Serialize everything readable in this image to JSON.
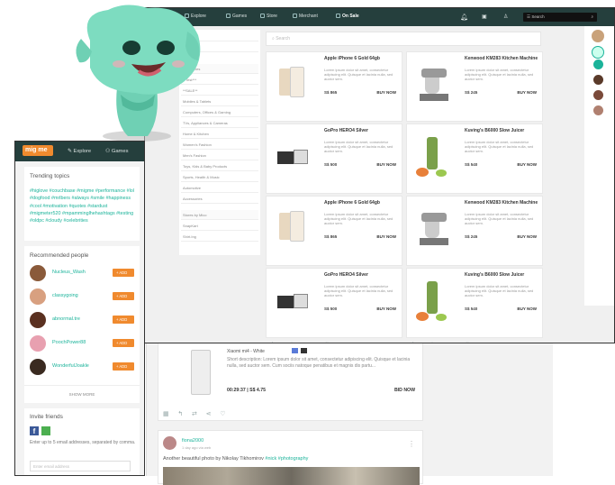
{
  "topnav": {
    "explore": "Explore",
    "games": "Games",
    "store": "Store",
    "merchant": "Merchant",
    "onsale": "On Sale",
    "search_label": "Search"
  },
  "search_placeholder": "Search",
  "categories": {
    "top": [
      "Games",
      "Ringtones",
      "Categories",
      "**Test***",
      "**SALE**",
      "Mobiles & Tablets",
      "Computers, Offices & Gaming",
      "TVs, Appliances & Cameras",
      "Home & Kitchen",
      "Women's Fashion",
      "Men's Fashion",
      "Toys, Kids & Baby Products",
      "Sports, Health & Music",
      "Automotive",
      "Accessories"
    ],
    "section": "Stores by Mico",
    "stores": [
      "SnapKart",
      "Shirt.Ing"
    ]
  },
  "products": [
    {
      "title": "Apple iPhone 6 Gold 64gb",
      "desc": "Lorem ipsum dolor sit amet, consectetur adipiscing elit. Quisque et lacinia nulla, sed auctor sem.",
      "price": "S$ 865",
      "buy": "BUY NOW"
    },
    {
      "title": "Kenwood KM283 Kitchen Machine",
      "desc": "Lorem ipsum dolor sit amet, consectetur adipiscing elit. Quisque et lacinia nulla, sed auctor sem.",
      "price": "S$ 245",
      "buy": "BUY NOW"
    },
    {
      "title": "GoPro HERO4 Silver",
      "desc": "Lorem ipsum dolor sit amet, consectetur adipiscing elit. Quisque et lacinia nulla, sed auctor sem.",
      "price": "S$ 500",
      "buy": "BUY NOW"
    },
    {
      "title": "Kuving's B6000 Slow Juicer",
      "desc": "Lorem ipsum dolor sit amet, consectetur adipiscing elit. Quisque et lacinia nulla, sed auctor sem.",
      "price": "S$ 540",
      "buy": "BUY NOW"
    },
    {
      "title": "Apple iPhone 6 Gold 64gb",
      "desc": "Lorem ipsum dolor sit amet, consectetur adipiscing elit. Quisque et lacinia nulla, sed auctor sem.",
      "price": "S$ 865",
      "buy": "BUY NOW"
    },
    {
      "title": "Kenwood KM283 Kitchen Machine",
      "desc": "Lorem ipsum dolor sit amet, consectetur adipiscing elit. Quisque et lacinia nulla, sed auctor sem.",
      "price": "S$ 245",
      "buy": "BUY NOW"
    },
    {
      "title": "GoPro HERO4 Silver",
      "desc": "Lorem ipsum dolor sit amet, consectetur adipiscing elit. Quisque et lacinia nulla, sed auctor sem.",
      "price": "S$ 500",
      "buy": "BUY NOW"
    },
    {
      "title": "Kuving's B6000 Slow Juicer",
      "desc": "Lorem ipsum dolor sit amet, consectetur adipiscing elit. Quisque et lacinia nulla, sed auctor sem.",
      "price": "S$ 540",
      "buy": "BUY NOW"
    }
  ],
  "leftwin": {
    "logo": "mig me",
    "explore": "Explore",
    "games": "Games",
    "trending_title": "Trending topics",
    "trending_text": "#higlove #couchbase #migme #performance #lol #dogfood #mrlbers #always #smile #happiness #cool #motivation #quotes #stardust #migmeter520 #mpamminglhehashtags #testing #oldpc #cloudy #celebrities",
    "recommended_title": "Recommended people",
    "people": [
      "Nucleus_Wash",
      "classygoing",
      "abnormal.tre",
      "PoochPower88",
      "WonderfulJoakle"
    ],
    "add_label": "+ ADD",
    "show_more": "SHOW MORE",
    "invite_title": "Invite friends",
    "invite_text": "Enter up to 5 email addresses, separated by comma.",
    "invite_placeholder": "Enter email address"
  },
  "feed": {
    "post1_title": "Xiaomi mi4 - White",
    "post1_desc": "Short description: Lorem ipsum dolor sit amet, consectetur adipiscing elit. Quisque et lacinia nulla, sed auctor sem. Cum sociis natoque penatibus et magnis dis partu...",
    "post1_time": "00:29:37",
    "post1_price": "S$ 4.75",
    "post1_bid": "BID NOW",
    "post2_user": "fiona2000",
    "post2_time": "1 day ago via web",
    "post2_text": "Another beautiful photo by Nikolay Tikhomirov ",
    "post2_tags": "#nick #photography"
  }
}
